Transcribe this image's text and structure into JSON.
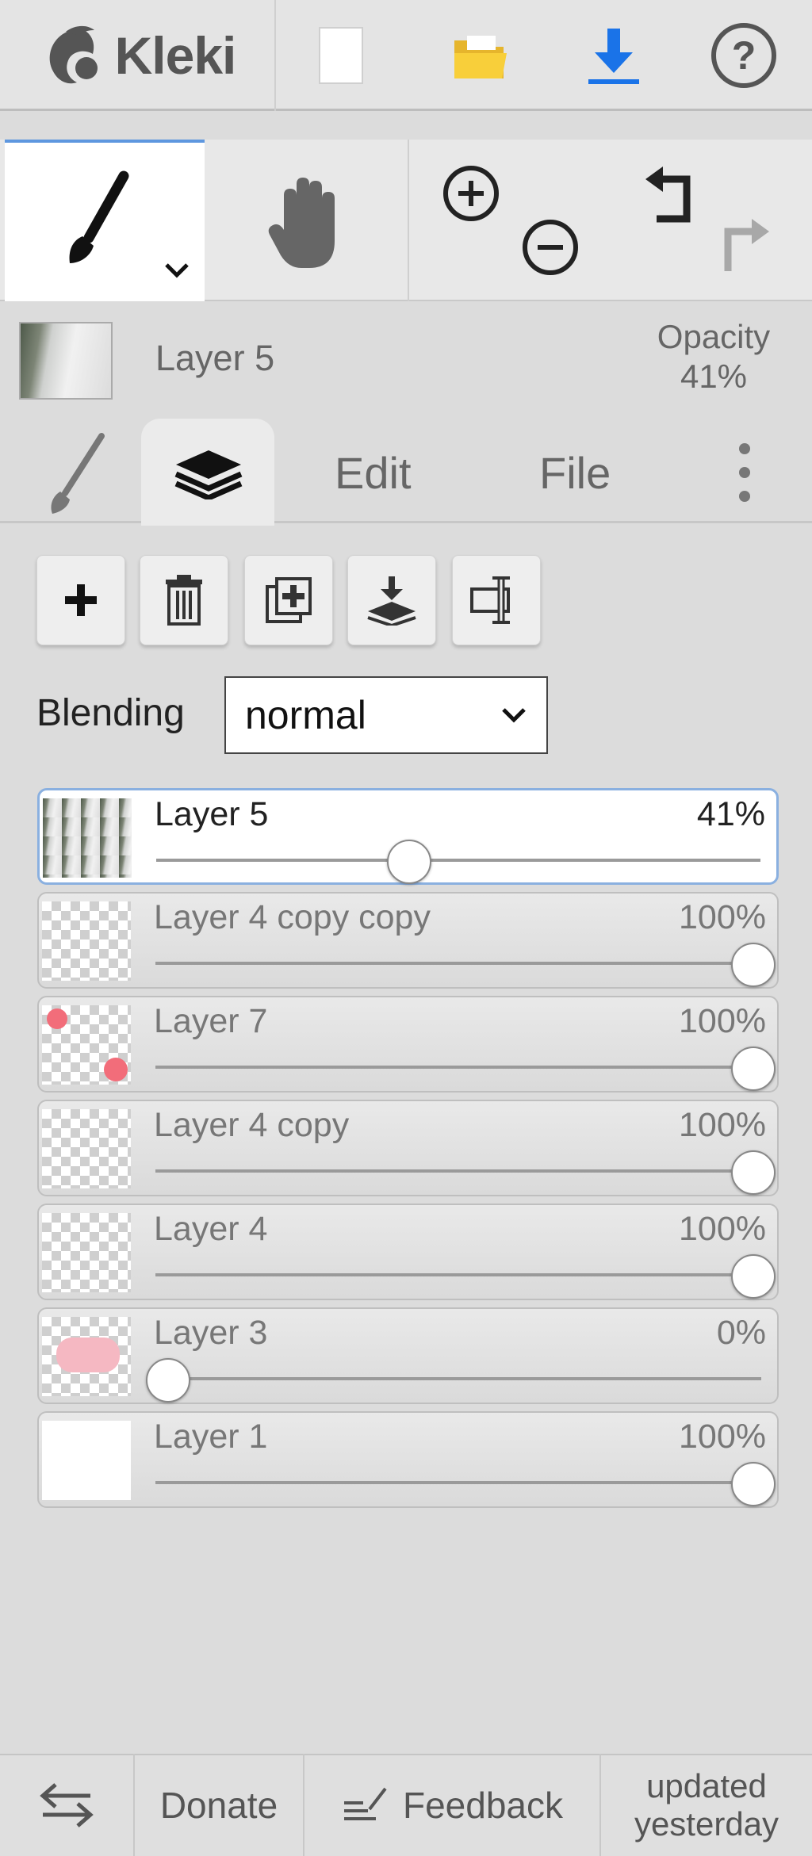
{
  "app": {
    "name": "Kleki"
  },
  "toolbar": {
    "items": [
      "logo-icon",
      "new-file-icon",
      "open-folder-icon",
      "download-icon",
      "help-icon"
    ]
  },
  "tools": {
    "active": "brush",
    "zoom": [
      "zoom-in-icon",
      "zoom-out-icon"
    ],
    "history": [
      "undo-icon",
      "redo-icon"
    ]
  },
  "current_layer": {
    "name": "Layer 5",
    "opacity_label": "Opacity",
    "opacity_value": "41%"
  },
  "tabs": {
    "active": "layers",
    "edit": "Edit",
    "file": "File"
  },
  "layer_actions": [
    "add-layer-icon",
    "delete-layer-icon",
    "duplicate-layer-icon",
    "merge-down-icon",
    "rename-layer-icon"
  ],
  "blending": {
    "label": "Blending",
    "value": "normal"
  },
  "layers": [
    {
      "name": "Layer 5",
      "opacity": "41%",
      "level": 0.41,
      "selected": true
    },
    {
      "name": "Layer 4 copy copy",
      "opacity": "100%",
      "level": 1.0,
      "selected": false
    },
    {
      "name": "Layer 7",
      "opacity": "100%",
      "level": 1.0,
      "selected": false
    },
    {
      "name": "Layer 4 copy",
      "opacity": "100%",
      "level": 1.0,
      "selected": false
    },
    {
      "name": "Layer 4",
      "opacity": "100%",
      "level": 1.0,
      "selected": false
    },
    {
      "name": "Layer 3",
      "opacity": "0%",
      "level": 0.0,
      "selected": false
    },
    {
      "name": "Layer 1",
      "opacity": "100%",
      "level": 1.0,
      "selected": false
    }
  ],
  "footer": {
    "donate": "Donate",
    "feedback": "Feedback",
    "updated_line1": "updated",
    "updated_line2": "yesterday"
  },
  "colors": {
    "accent": "#5e97df",
    "download": "#1a73e8",
    "folder": "#f4c430"
  }
}
